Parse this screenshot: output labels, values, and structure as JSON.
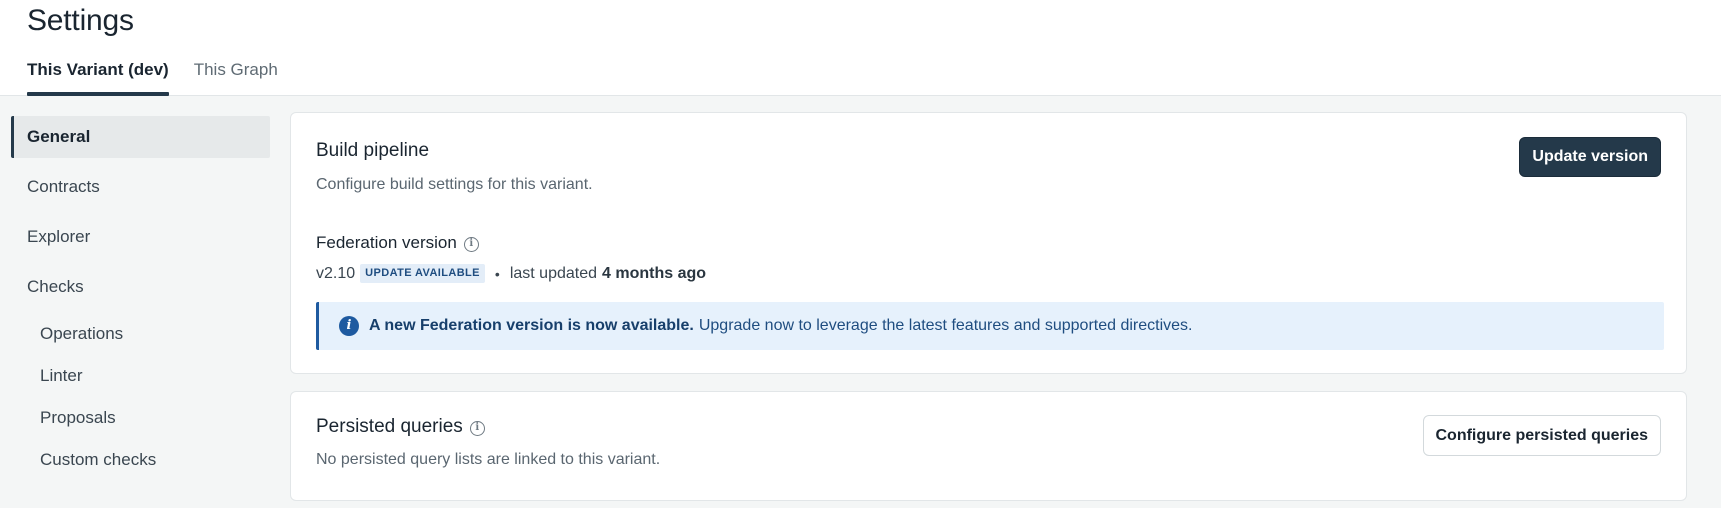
{
  "header": {
    "title": "Settings",
    "tabs": [
      {
        "label": "This Variant (dev)",
        "active": true
      },
      {
        "label": "This Graph",
        "active": false
      }
    ]
  },
  "sidebar": {
    "items": [
      {
        "label": "General",
        "active": true
      },
      {
        "label": "Contracts"
      },
      {
        "label": "Explorer"
      },
      {
        "label": "Checks"
      },
      {
        "label": "Operations",
        "sub": true
      },
      {
        "label": "Linter",
        "sub": true
      },
      {
        "label": "Proposals",
        "sub": true
      },
      {
        "label": "Custom checks",
        "sub": true
      }
    ]
  },
  "build_pipeline": {
    "title": "Build pipeline",
    "description": "Configure build settings for this variant.",
    "button_label": "Update version",
    "federation_label": "Federation version",
    "version": "v2.10",
    "badge": "UPDATE AVAILABLE",
    "separator": "•",
    "last_updated_prefix": "last updated",
    "last_updated_value": "4 months ago",
    "banner_bold": "A new Federation version is now available.",
    "banner_text": "Upgrade now to leverage the latest features and supported directives."
  },
  "persisted_queries": {
    "title": "Persisted queries",
    "description": "No persisted query lists are linked to this variant.",
    "button_label": "Configure persisted queries"
  },
  "colors": {
    "accent_dark": "#24394a",
    "info_blue": "#1e5aa0",
    "banner_bg": "#e6f1fc"
  }
}
